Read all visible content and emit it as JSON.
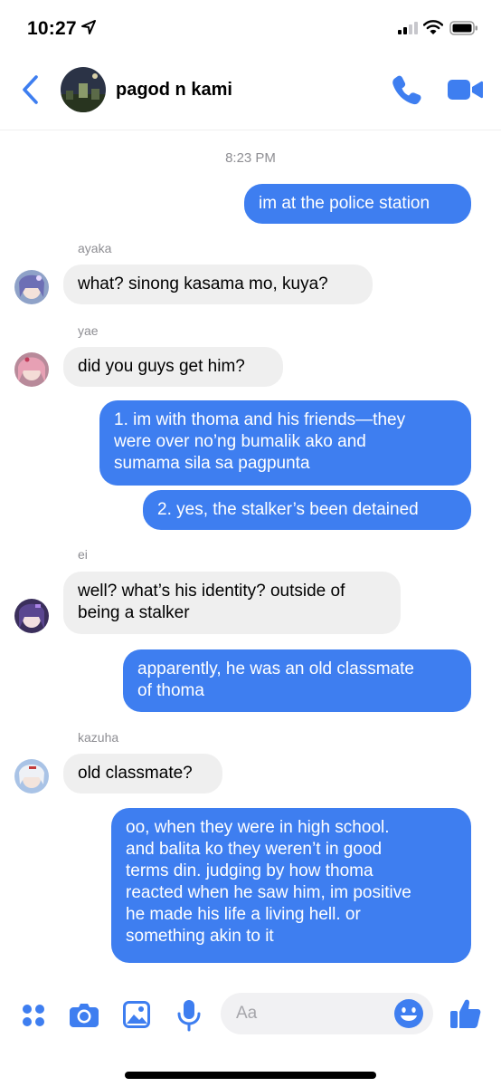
{
  "status_bar": {
    "time": "10:27"
  },
  "header": {
    "title": "pagod n kami"
  },
  "conversation": {
    "timestamp": "8:23 PM",
    "msg1": "im at the police station",
    "ayaka": {
      "name": "ayaka",
      "text": "what? sinong kasama mo, kuya?"
    },
    "yae": {
      "name": "yae",
      "text": "did you guys get him?"
    },
    "msg2": [
      "1. im with thoma and his friends—they",
      "were over no’ng bumalik ako and",
      "sumama sila sa pagpunta"
    ],
    "msg3": "2. yes, the stalker’s been detained",
    "ei": {
      "name": "ei",
      "lines": [
        "well? what’s his identity? outside of",
        "being a stalker"
      ]
    },
    "msg4": [
      "apparently, he was an old classmate",
      "of thoma"
    ],
    "kazuha": {
      "name": "kazuha",
      "text": "old classmate?"
    },
    "msg5": [
      "oo, when they were in high school.",
      "and balita ko they weren’t in good",
      "terms din. judging by how thoma",
      "reacted when he saw him, im positive",
      "he made his life a living hell. or",
      "something akin to it"
    ]
  },
  "composer": {
    "placeholder": "Aa"
  },
  "colors": {
    "accent": "#3e7ef0",
    "incoming_bubble": "#efefef",
    "meta_text": "#8e8e93"
  },
  "icons": [
    "location-arrow-icon",
    "signal-icon",
    "wifi-icon",
    "battery-icon",
    "back-chevron-icon",
    "phone-icon",
    "video-camera-icon",
    "apps-grid-icon",
    "camera-icon",
    "gallery-icon",
    "microphone-icon",
    "emoji-icon",
    "thumbs-up-icon"
  ]
}
